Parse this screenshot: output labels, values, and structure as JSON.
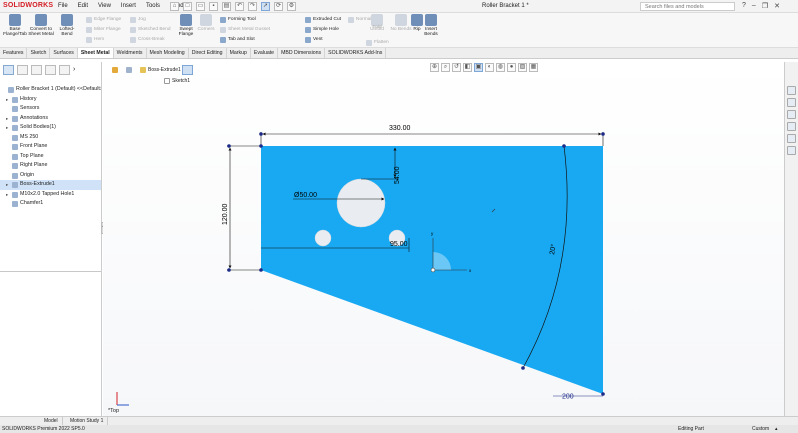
{
  "app": {
    "logo": "SOLIDWORKS",
    "document_title": "Roller Bracket 1 *",
    "search_placeholder": "Search files and models",
    "menus": [
      "File",
      "Edit",
      "View",
      "Insert",
      "Tools",
      "Window"
    ],
    "window_controls": [
      "?",
      "–",
      "❐",
      "✕"
    ]
  },
  "ribbon": {
    "big_tools": [
      {
        "label": "Base Flange/Tab",
        "icon": "base-flange-icon",
        "enabled": true
      },
      {
        "label": "Convert to Sheet Metal",
        "icon": "convert-sheet-metal-icon",
        "enabled": true
      },
      {
        "label": "Lofted-Bend",
        "icon": "lofted-bend-icon",
        "enabled": true
      },
      {
        "label": "Swept Flange",
        "icon": "swept-flange-icon",
        "enabled": true
      },
      {
        "label": "Corners",
        "icon": "corners-icon",
        "enabled": false
      },
      {
        "label": "Unfold",
        "icon": "unfold-icon",
        "enabled": false
      },
      {
        "label": "Fold",
        "icon": "fold-icon",
        "enabled": false
      },
      {
        "label": "No Bends",
        "icon": "no-bends-icon",
        "enabled": false
      },
      {
        "label": "Rip",
        "icon": "rip-icon",
        "enabled": true
      },
      {
        "label": "Insert Bends",
        "icon": "insert-bends-icon",
        "enabled": true
      }
    ],
    "small_tools": [
      {
        "label": "Edge Flange",
        "enabled": false
      },
      {
        "label": "Miter Flange",
        "enabled": false
      },
      {
        "label": "Hem",
        "enabled": false
      },
      {
        "label": "Jog",
        "enabled": false
      },
      {
        "label": "Sketched Bend",
        "enabled": false
      },
      {
        "label": "Cross-Break",
        "enabled": false
      },
      {
        "label": "Forming Tool",
        "enabled": true
      },
      {
        "label": "Sheet Metal Gusset",
        "enabled": false
      },
      {
        "label": "Tab and Slot",
        "enabled": true
      },
      {
        "label": "Extruded Cut",
        "enabled": true
      },
      {
        "label": "Simple Hole",
        "enabled": true
      },
      {
        "label": "Vent",
        "enabled": true
      },
      {
        "label": "Normal Cut",
        "enabled": false
      },
      {
        "label": "Flatten",
        "enabled": false
      }
    ]
  },
  "tabs": [
    "Features",
    "Sketch",
    "Surfaces",
    "Sheet Metal",
    "Weldments",
    "Mesh Modeling",
    "Direct Editing",
    "Markup",
    "Evaluate",
    "MBD Dimensions",
    "SOLIDWORKS Add-Ins"
  ],
  "active_tab": "Sheet Metal",
  "feature_tree": [
    {
      "label": "Roller Bracket 1 (Default) <<Default>_Di",
      "icon": "part-icon",
      "expand": "",
      "indent": 0
    },
    {
      "label": "History",
      "icon": "history-icon",
      "expand": "▸",
      "indent": 1
    },
    {
      "label": "Sensors",
      "icon": "sensors-icon",
      "expand": "",
      "indent": 1
    },
    {
      "label": "Annotations",
      "icon": "annotations-icon",
      "expand": "▸",
      "indent": 1
    },
    {
      "label": "Solid Bodies(1)",
      "icon": "solid-bodies-icon",
      "expand": "▸",
      "indent": 1
    },
    {
      "label": "MS 250",
      "icon": "material-icon",
      "expand": "",
      "indent": 1
    },
    {
      "label": "Front Plane",
      "icon": "plane-icon",
      "expand": "",
      "indent": 1
    },
    {
      "label": "Top Plane",
      "icon": "plane-icon",
      "expand": "",
      "indent": 1
    },
    {
      "label": "Right Plane",
      "icon": "plane-icon",
      "expand": "",
      "indent": 1
    },
    {
      "label": "Origin",
      "icon": "origin-icon",
      "expand": "",
      "indent": 1
    },
    {
      "label": "Boss-Extrude1",
      "icon": "boss-extrude-icon",
      "expand": "▸",
      "indent": 1,
      "selected": true
    },
    {
      "label": "M10x2.0 Tapped Hole1",
      "icon": "tapped-hole-icon",
      "expand": "▸",
      "indent": 1
    },
    {
      "label": "Chamfer1",
      "icon": "chamfer-icon",
      "expand": "",
      "indent": 1
    }
  ],
  "breadcrumb": {
    "feature": "Boss-Extrude1",
    "sketch": "Sketch1"
  },
  "dimensions": {
    "width": "330.00",
    "height": "120.00",
    "offset": "54.00",
    "diameter": "Ø50.00",
    "spacing": "95.00",
    "angle": "20°",
    "scale_text": "200"
  },
  "view": {
    "orientation": "*Top"
  },
  "colors": {
    "part_face": "#19a9f2",
    "dimension": "#111111",
    "sketch_point": "#1c2a88",
    "selection": "#cfe2f7"
  },
  "doc_tabs": [
    "Model",
    "Motion Study 1"
  ],
  "active_doc_tab": "Model",
  "status": {
    "product": "SOLIDWORKS Premium 2022 SP5.0",
    "mode": "Editing Part",
    "units": "Custom"
  }
}
